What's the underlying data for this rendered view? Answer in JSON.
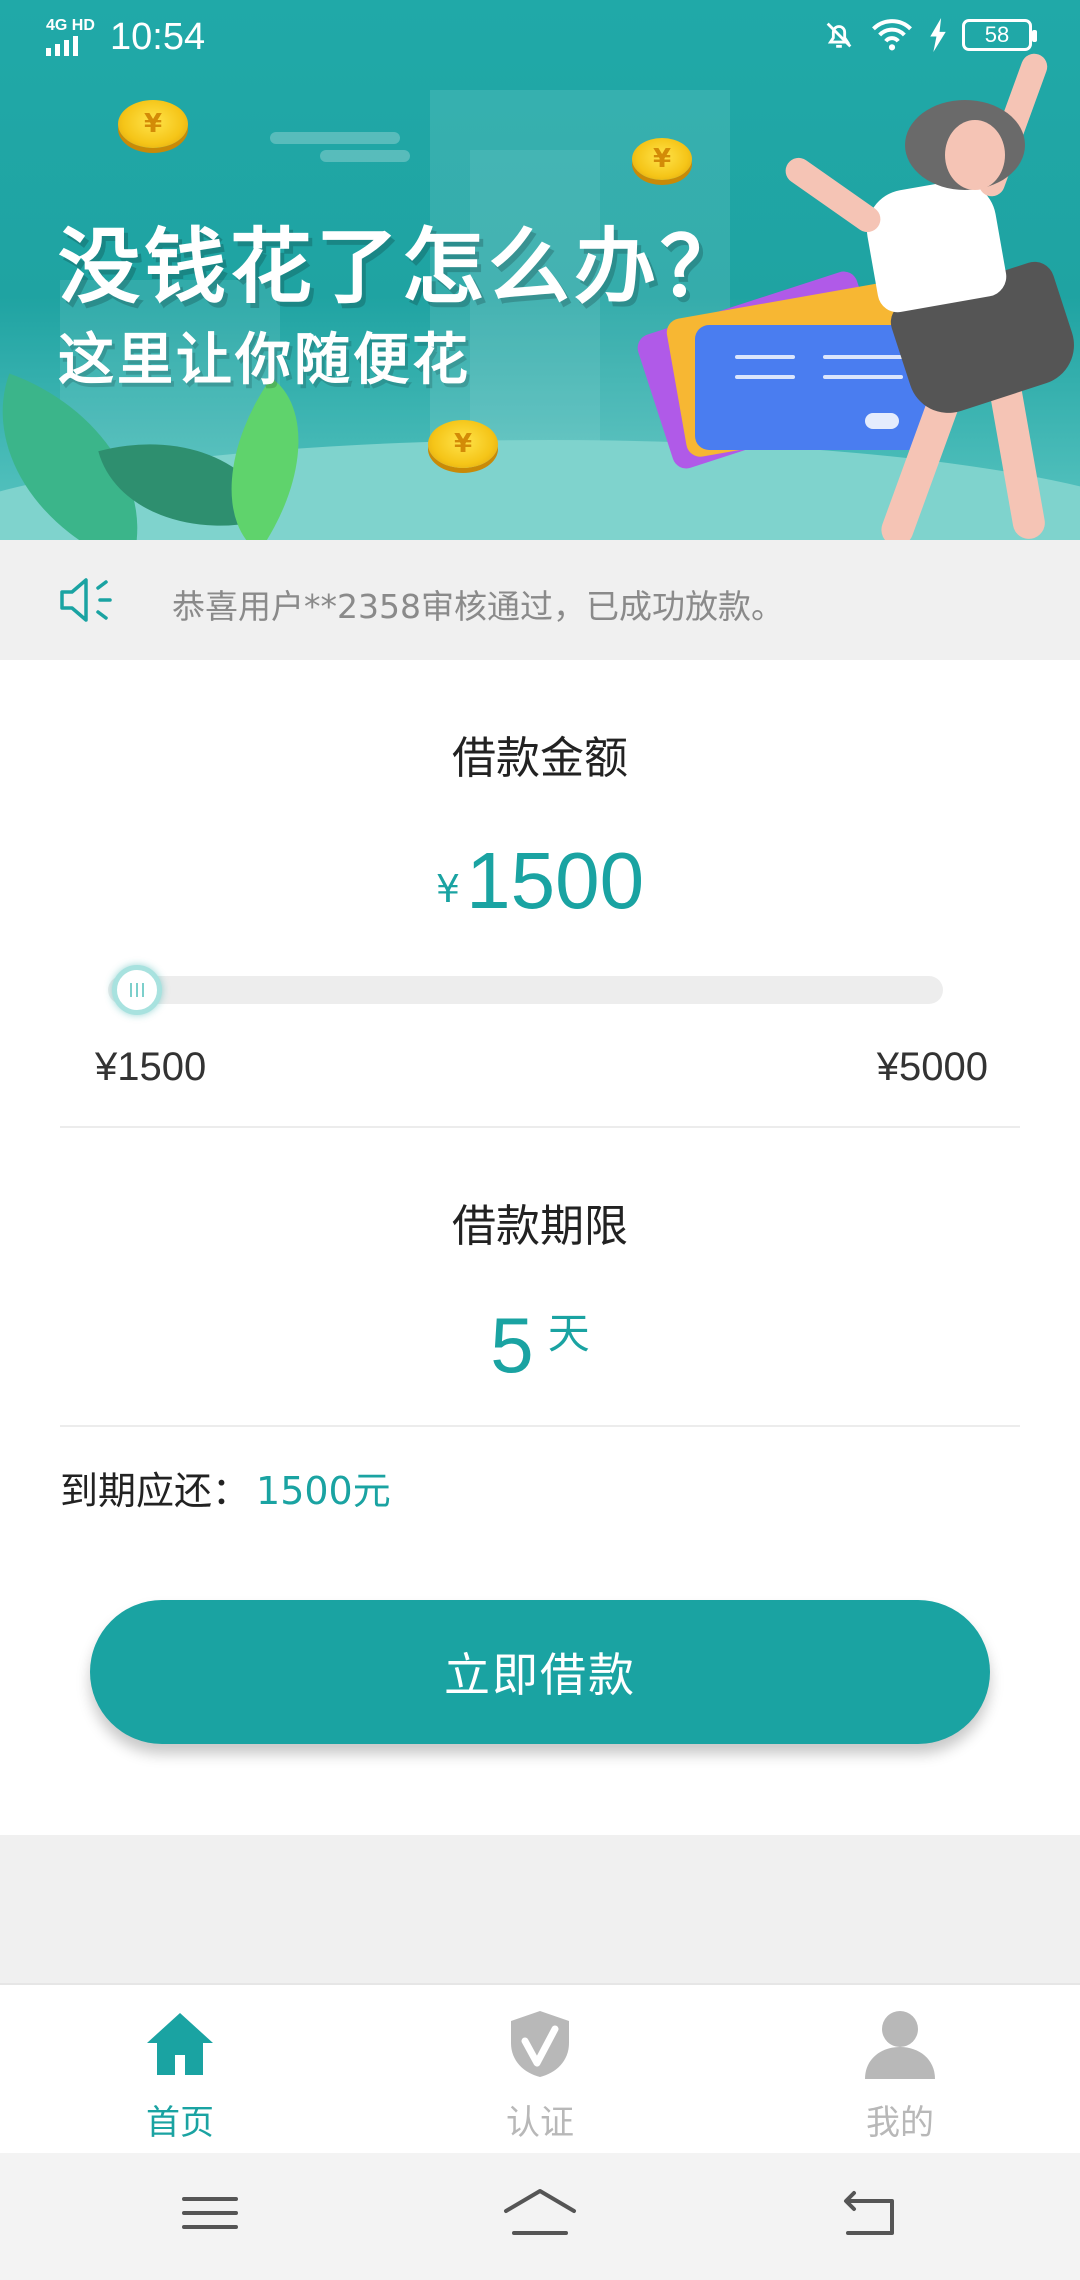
{
  "status_bar": {
    "network": "4G HD",
    "time": "10:54",
    "battery": "58"
  },
  "banner": {
    "title": "没钱花了怎么办？",
    "subtitle": "这里让你随便花"
  },
  "notice": {
    "text": "恭喜用户**2358审核通过，已成功放款。"
  },
  "loan": {
    "amount_label": "借款金额",
    "currency": "¥",
    "amount": "1500",
    "slider_value": 1500,
    "slider_min": 1500,
    "slider_max": 5000,
    "min_label": "¥1500",
    "max_label": "¥5000",
    "term_label": "借款期限",
    "term_value": "5",
    "term_unit": "天",
    "due_label": "到期应还：",
    "due_value": "1500元",
    "submit_label": "立即借款"
  },
  "tabs": [
    {
      "label": "首页",
      "icon": "home-icon",
      "active": true
    },
    {
      "label": "认证",
      "icon": "shield-check-icon",
      "active": false
    },
    {
      "label": "我的",
      "icon": "user-icon",
      "active": false
    }
  ],
  "colors": {
    "accent": "#1aa3a2",
    "tab_inactive": "#b8b8b8",
    "notice_text": "#8a8a8a"
  },
  "nav_bar": {
    "buttons": [
      "menu-icon",
      "home-outline-icon",
      "back-icon"
    ]
  }
}
